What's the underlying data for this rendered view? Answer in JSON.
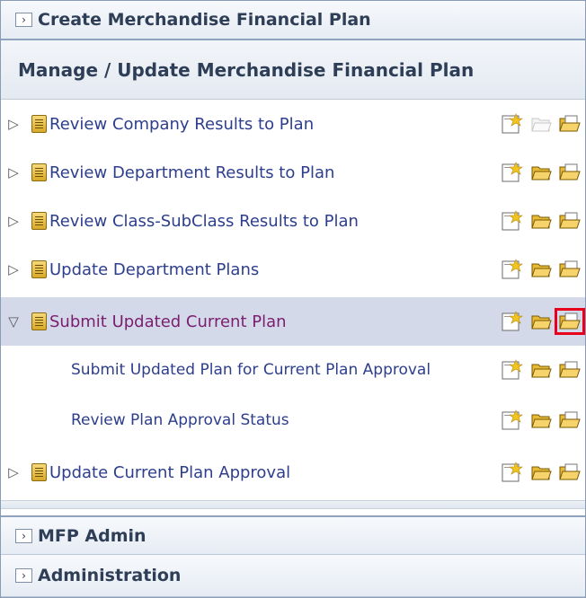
{
  "tiles": {
    "create_title": "Create Merchandise Financial Plan",
    "mfp_admin_title": "MFP Admin",
    "administration_title": "Administration"
  },
  "section": {
    "title": "Manage / Update Merchandise Financial Plan"
  },
  "rows": {
    "review_company": "Review Company Results to Plan",
    "review_department": "Review Department Results to Plan",
    "review_class": "Review Class-SubClass Results to Plan",
    "update_department": "Update Department Plans",
    "submit_updated": "Submit Updated Current Plan",
    "submit_for_approval": "Submit Updated Plan for Current Plan Approval",
    "review_approval_status": "Review Plan Approval Status",
    "update_approval": "Update Current Plan Approval"
  },
  "glyphs": {
    "collapsed": "▷",
    "expanded": "▽",
    "tile_chevron": "›"
  },
  "icons": {
    "row": "task-icon",
    "new": "new-document-icon",
    "open": "open-folder-icon",
    "open_alt": "open-folder-alt-icon"
  },
  "colors": {
    "selected_row_bg": "#d4d9ea",
    "highlight_box": "#e8001c",
    "label_color": "#2d3e8c",
    "selected_label_color": "#7a1e6e"
  }
}
